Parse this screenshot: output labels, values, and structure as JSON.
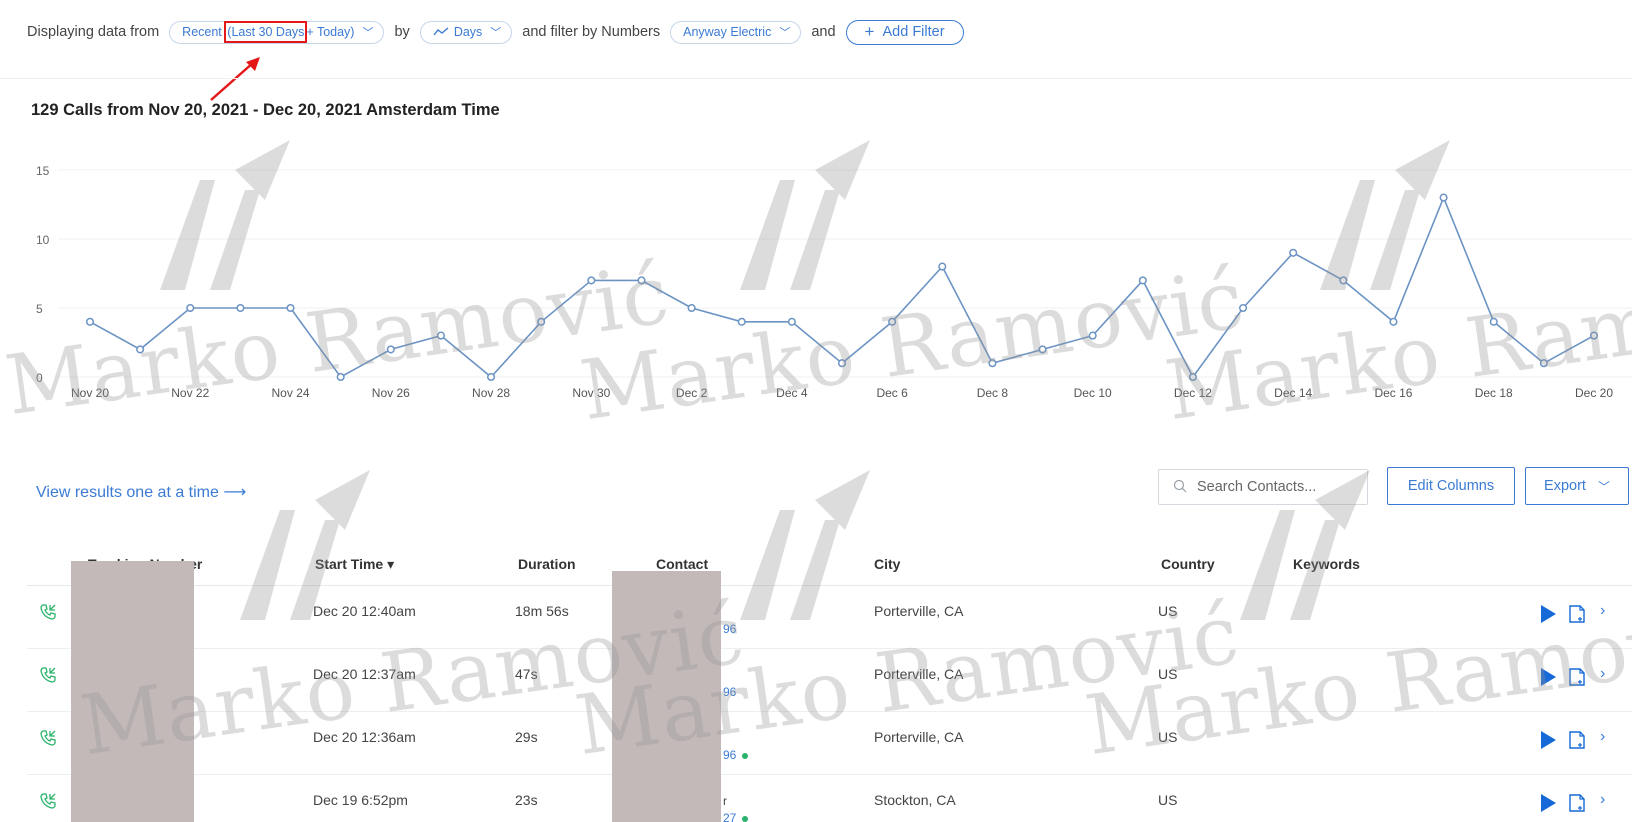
{
  "filter_bar": {
    "label_from": "Displaying data from",
    "range_prefix": "Recent",
    "range_highlight": "Last 30 Days",
    "range_suffix": "+ Today)",
    "label_by": "by",
    "interval": "Days",
    "label_filter": "and filter by Numbers",
    "number_filter": "Anyway Electric",
    "label_and": "and",
    "add_filter": "Add Filter"
  },
  "chart_data": {
    "type": "line",
    "title": "129 Calls from Nov 20, 2021 - Dec 20, 2021 Amsterdam Time",
    "x": [
      "Nov 20",
      "Nov 21",
      "Nov 22",
      "Nov 23",
      "Nov 24",
      "Nov 25",
      "Nov 26",
      "Nov 27",
      "Nov 28",
      "Nov 29",
      "Nov 30",
      "Dec 1",
      "Dec 2",
      "Dec 3",
      "Dec 4",
      "Dec 5",
      "Dec 6",
      "Dec 7",
      "Dec 8",
      "Dec 9",
      "Dec 10",
      "Dec 11",
      "Dec 12",
      "Dec 13",
      "Dec 14",
      "Dec 15",
      "Dec 16",
      "Dec 17",
      "Dec 18",
      "Dec 19",
      "Dec 20"
    ],
    "tick_labels": [
      "Nov 20",
      "Nov 22",
      "Nov 24",
      "Nov 26",
      "Nov 28",
      "Nov 30",
      "Dec 2",
      "Dec 4",
      "Dec 6",
      "Dec 8",
      "Dec 10",
      "Dec 12",
      "Dec 14",
      "Dec 16",
      "Dec 18",
      "Dec 20"
    ],
    "y_ticks": [
      "15",
      "10",
      "5",
      "0"
    ],
    "series": [
      {
        "values": [
          4,
          2,
          5,
          5,
          5,
          0,
          2,
          3,
          0,
          4,
          7,
          7,
          5,
          4,
          4,
          1,
          4,
          8,
          1,
          2,
          3,
          7,
          0,
          5,
          9,
          7,
          4,
          13,
          4,
          1,
          3
        ]
      }
    ],
    "ylim": [
      0,
      15
    ],
    "grid": true,
    "color": "#6b93c4"
  },
  "toolbar": {
    "view_link": "View results one at a time",
    "view_arrow": "⟶",
    "search_placeholder": "Search Contacts...",
    "edit_columns": "Edit Columns",
    "export": "Export"
  },
  "table": {
    "headers": {
      "tracking_number": "Tracking Number",
      "start_time": "Start Time ▾",
      "duration": "Duration",
      "contact": "Contact",
      "city": "City",
      "country": "Country",
      "keywords": "Keywords"
    },
    "rows": [
      {
        "start_time": "Dec 20 12:40am",
        "duration": "18m 56s",
        "contact_tail": "96",
        "contact_line1": "",
        "city": "Porterville, CA",
        "country": "US"
      },
      {
        "start_time": "Dec 20 12:37am",
        "duration": "47s",
        "contact_tail": "96",
        "contact_line1": "",
        "city": "Porterville, CA",
        "country": "US"
      },
      {
        "start_time": "Dec 20 12:36am",
        "duration": "29s",
        "contact_tail": "96",
        "contact_line1": "",
        "city": "Porterville, CA",
        "country": "US"
      },
      {
        "start_time": "Dec 19 6:52pm",
        "duration": "23s",
        "contact_tail": "27",
        "contact_line1": "r",
        "city": "Stockton, CA",
        "country": "US"
      }
    ]
  },
  "watermark": {
    "text": "Marko Ramović"
  }
}
